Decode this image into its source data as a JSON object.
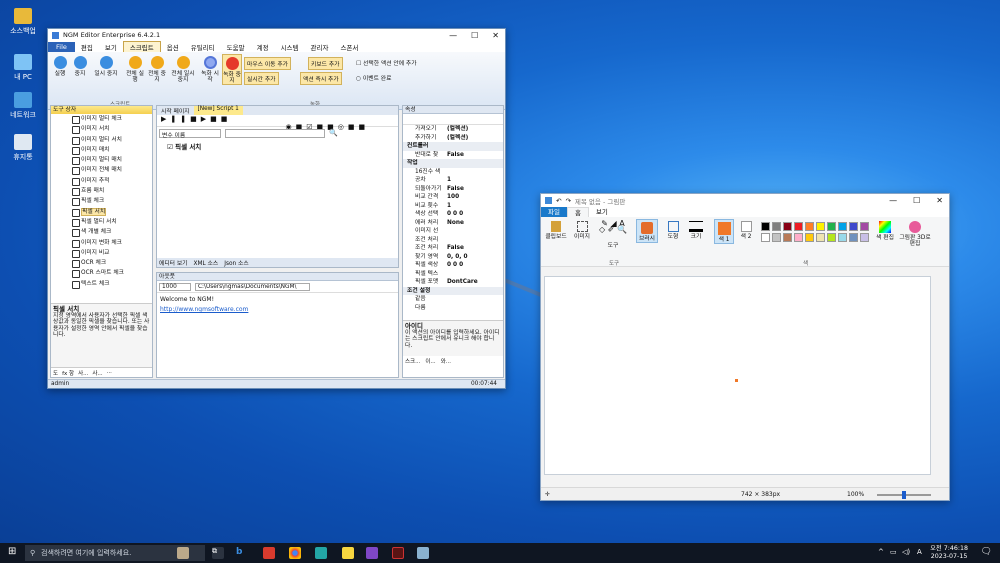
{
  "desktop": {
    "icons": [
      "소스백업",
      "내 PC",
      "네트워크",
      "휴지통"
    ]
  },
  "ngm": {
    "title": "NGM Editor  Enterprise 6.4.2.1",
    "menu": [
      "File",
      "편집",
      "보기",
      "스크립트",
      "옵션",
      "유틸리티",
      "도움말",
      "계정",
      "시스템",
      "관리자",
      "스폰서"
    ],
    "ribbon": {
      "buttons": [
        "실행",
        "중지",
        "일시 중지",
        "전체 실행",
        "전체 중지",
        "전체 일시 중지",
        "녹화 시작",
        "녹화 중지"
      ],
      "small": [
        "마우스 이동 추가",
        "키보드 추가",
        "실시간 추가",
        "액션 즉시 추가"
      ],
      "checks": [
        "선택한 액션 안에 추가",
        "이벤트 완료"
      ],
      "group_script": "스크립트",
      "group_record": "녹화"
    },
    "toolbox": {
      "title": "도구 상자",
      "items": [
        "이미지 멀티 체크",
        "이미지 서치",
        "이미지 멀티 서치",
        "이미지 매치",
        "이미지 멀티 매치",
        "이미지 전체 매치",
        "이미지 추적",
        "흐름 매치",
        "픽셀 체크",
        "픽셀 서치",
        "픽셀 멀티 서치",
        "색 개별 체크",
        "이미지 변화 체크",
        "이미지 비교",
        "OCR 체크",
        "OCR 스마트 체크",
        "텍스트 체크"
      ],
      "selected": "픽셀 서치",
      "desc_title": "픽셀 서치",
      "desc_text": "지정 영역에서 사용자가 선택한 픽셀 색상값과 동일한 픽셀을 찾습니다. 또는 사용자가 설정한 영역 안에서 픽셀을 찾습니다.",
      "tabs": [
        "도",
        "fx 항",
        "사...",
        "사...",
        "..."
      ]
    },
    "editor": {
      "tabs": [
        "시작 페이지",
        "[New] Script 1"
      ],
      "var_label": "변수 이름",
      "action": "픽셀 서치",
      "bottom_tabs": [
        "에디터 보기",
        "XML 소스",
        "Json 소스"
      ]
    },
    "output": {
      "title": "아웃풋",
      "count": "1000",
      "path": "C:\\Users\\ngmas\\Documents\\NGM\\",
      "welcome": "Welcome to NGM!",
      "link": "http://www.ngmsoftware.com"
    },
    "props": {
      "title": "속성",
      "rows": [
        {
          "k": "가져오기",
          "v": "(컬렉션)",
          "cat": false
        },
        {
          "k": "추가하기",
          "v": "(컬렉션)",
          "cat": false
        },
        {
          "k": "컨트롤러",
          "v": "",
          "cat": true
        },
        {
          "k": "반대로 찾",
          "v": "False",
          "cat": false
        },
        {
          "k": "작업",
          "v": "",
          "cat": true
        },
        {
          "k": "16진수 색",
          "v": "",
          "cat": false
        },
        {
          "k": "공차",
          "v": "1",
          "cat": false
        },
        {
          "k": "되돌아가기",
          "v": "False",
          "cat": false
        },
        {
          "k": "비교 간격",
          "v": "100",
          "cat": false
        },
        {
          "k": "비교 횟수",
          "v": "1",
          "cat": false
        },
        {
          "k": "색상 선택",
          "v": "0 0 0",
          "cat": false
        },
        {
          "k": "에러 처리",
          "v": "None",
          "cat": false
        },
        {
          "k": "이미지 선",
          "v": "",
          "cat": false
        },
        {
          "k": "조건 처리",
          "v": "",
          "cat": false
        },
        {
          "k": "조건 처리",
          "v": "False",
          "cat": false
        },
        {
          "k": "찾기 영역",
          "v": "0, 0, 0",
          "cat": false
        },
        {
          "k": "픽셀 색상",
          "v": "0 0 0",
          "cat": false
        },
        {
          "k": "픽셀 텍스",
          "v": "",
          "cat": false
        },
        {
          "k": "픽셀 포맷",
          "v": "DontCare",
          "cat": false
        },
        {
          "k": "조건 설정",
          "v": "",
          "cat": true
        },
        {
          "k": "같음",
          "v": "",
          "cat": false
        },
        {
          "k": "다름",
          "v": "",
          "cat": false
        }
      ],
      "help_title": "아이디",
      "help_text": "이 액션의 아이디를 입력하세요. 아이디는 스크립트 안에서 유니크 해야 합니다.",
      "tabs": [
        "스크...",
        "이...",
        "와..."
      ]
    },
    "status_user": "admin",
    "status_time": "00:07:44"
  },
  "paint": {
    "title": "제목 없음 - 그림판",
    "tabs": [
      "파일",
      "홈",
      "보기"
    ],
    "tools": [
      "클립보드",
      "이미지",
      "도구",
      "브러시",
      "도형",
      "크기",
      "색 1",
      "색 2",
      "색 편집",
      "그림판 3D로 편집"
    ],
    "group_tools": "도구",
    "group_colors": "색",
    "dims": "742 × 383px",
    "zoom": "100%",
    "palette": [
      "#000000",
      "#7f7f7f",
      "#880015",
      "#ed1c24",
      "#ff7f27",
      "#fff200",
      "#22b14c",
      "#00a2e8",
      "#3f48cc",
      "#a349a4",
      "#ffffff",
      "#c3c3c3",
      "#b97a57",
      "#ffaec9",
      "#ffc90e",
      "#efe4b0",
      "#b5e61d",
      "#99d9ea",
      "#7092be",
      "#c8bfe7"
    ],
    "color1": "#f07828"
  },
  "taskbar": {
    "search_placeholder": "검색하려면 여기에 입력하세요.",
    "time": "오전 7:46:18",
    "date": "2023-07-15",
    "lang": "A"
  }
}
